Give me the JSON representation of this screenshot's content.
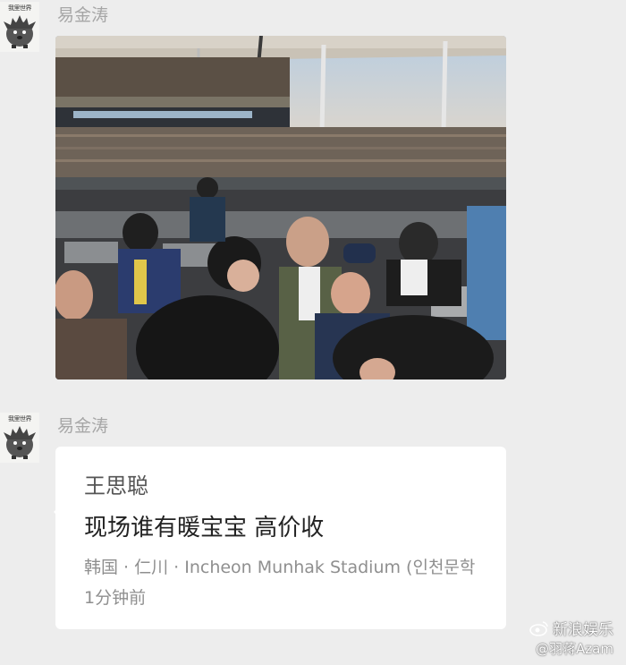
{
  "messages": [
    {
      "sender": "易金涛",
      "avatar_caption": "我里世界",
      "type": "photo"
    },
    {
      "sender": "易金涛",
      "avatar_caption": "我里世界",
      "type": "moments-card",
      "card": {
        "name": "王思聪",
        "text": "现场谁有暖宝宝 高价收",
        "location": "韩国 · 仁川 · Incheon Munhak Stadium (인천문학",
        "time": "1分钟前"
      }
    }
  ],
  "watermark": {
    "line1": "新浪娱乐",
    "line2": "@羽蒋Azam"
  },
  "icons": {
    "avatar": "hedgehog-avatar-icon",
    "watermark": "weibo-eye-icon"
  },
  "colors": {
    "background": "#ededed",
    "sender_name": "#a6a6a6",
    "card_background": "#ffffff",
    "card_meta": "#8f8f8f"
  }
}
